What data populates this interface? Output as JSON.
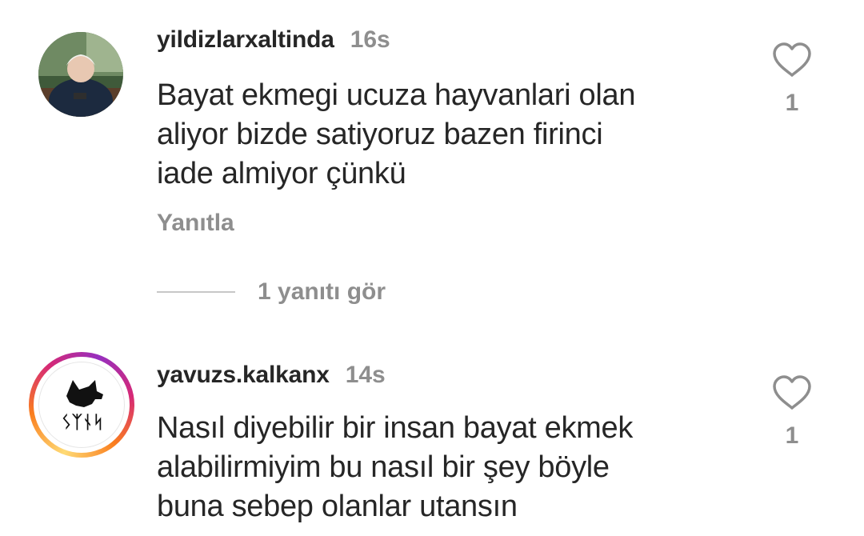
{
  "comments": [
    {
      "username": "yildizlarxaltinda",
      "time": "16s",
      "text": "Bayat ekmegi ucuza hayvanlari olan\naliyor bizde satiyoruz bazen firinci\niade almiyor çünkü",
      "reply_label": "Yanıtla",
      "like_count": "1",
      "view_replies_label": "1 yanıtı gör"
    },
    {
      "username": "yavuzs.kalkanx",
      "time": "14s",
      "text": "Nasıl diyebilir bir insan bayat ekmek\nalabilirmiyim bu nasıl bir şey böyle\nbuna sebep olanlar utansın",
      "like_count": "1",
      "avatar_text": "ᛊᛉᚾᛋ"
    }
  ],
  "icons": {
    "like": "heart-outline-icon"
  },
  "colors": {
    "text": "#262626",
    "muted": "#8e8e8e",
    "divider": "#c7c7c7",
    "story_ring": [
      "#feda75",
      "#fa7e1e",
      "#d62976",
      "#962fbf"
    ]
  }
}
